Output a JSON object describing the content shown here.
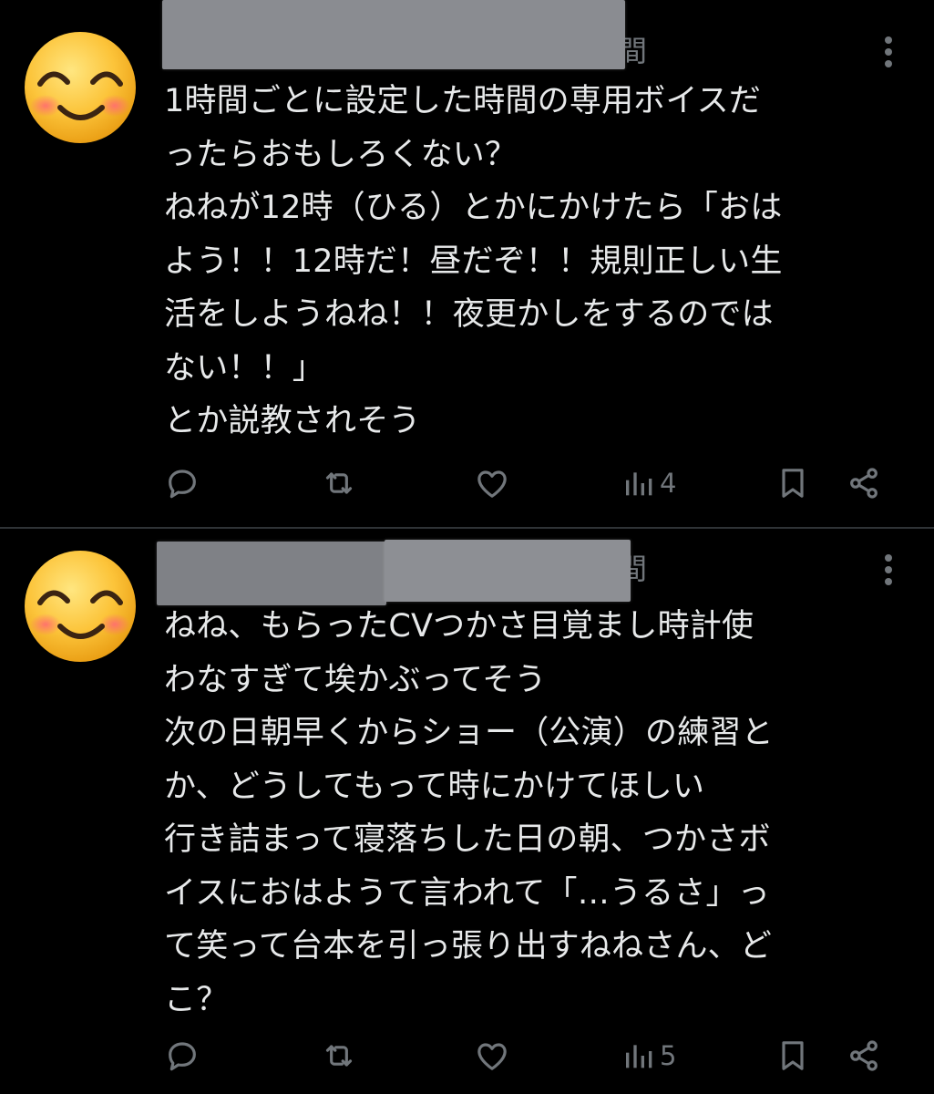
{
  "posts": [
    {
      "display_name_visible_tail": "間",
      "text": "1時間ごとに設定した時間の専用ボイスだ\nったらおもしろくない？\nねねが12時（ひる）とかにかけたら「おは\nよう！！12時だ！昼だぞ！！規則正しい生\n活をしようねね！！夜更かしをするのでは\nない！！」\nとか説教されそう",
      "views": "4",
      "avatar_emoji": "smiling-face-with-smiling-eyes"
    },
    {
      "display_name_visible_tail": "間",
      "text": "ねね、もらったCVつかさ目覚まし時計使\nわなすぎて埃かぶってそう\n次の日朝早くからショー（公演）の練習と\nか、どうしてもって時にかけてほしい\n行き詰まって寝落ちした日の朝、つかさボ\nイスにおはようて言われて「…うるさ」っ\nて笑って台本を引っ張り出すねねさん、ど\nこ？",
      "views": "5",
      "avatar_emoji": "smiling-face-with-smiling-eyes"
    }
  ],
  "icons": {
    "reply": "reply-icon",
    "repost": "repost-icon",
    "like": "like-icon",
    "views": "views-icon",
    "bookmark": "bookmark-icon",
    "share": "share-icon",
    "more": "more-icon"
  },
  "colors": {
    "background": "#000000",
    "text": "#e7e9ea",
    "muted": "#71767b",
    "divider": "#2f3336",
    "redaction": "#8a8c91"
  }
}
